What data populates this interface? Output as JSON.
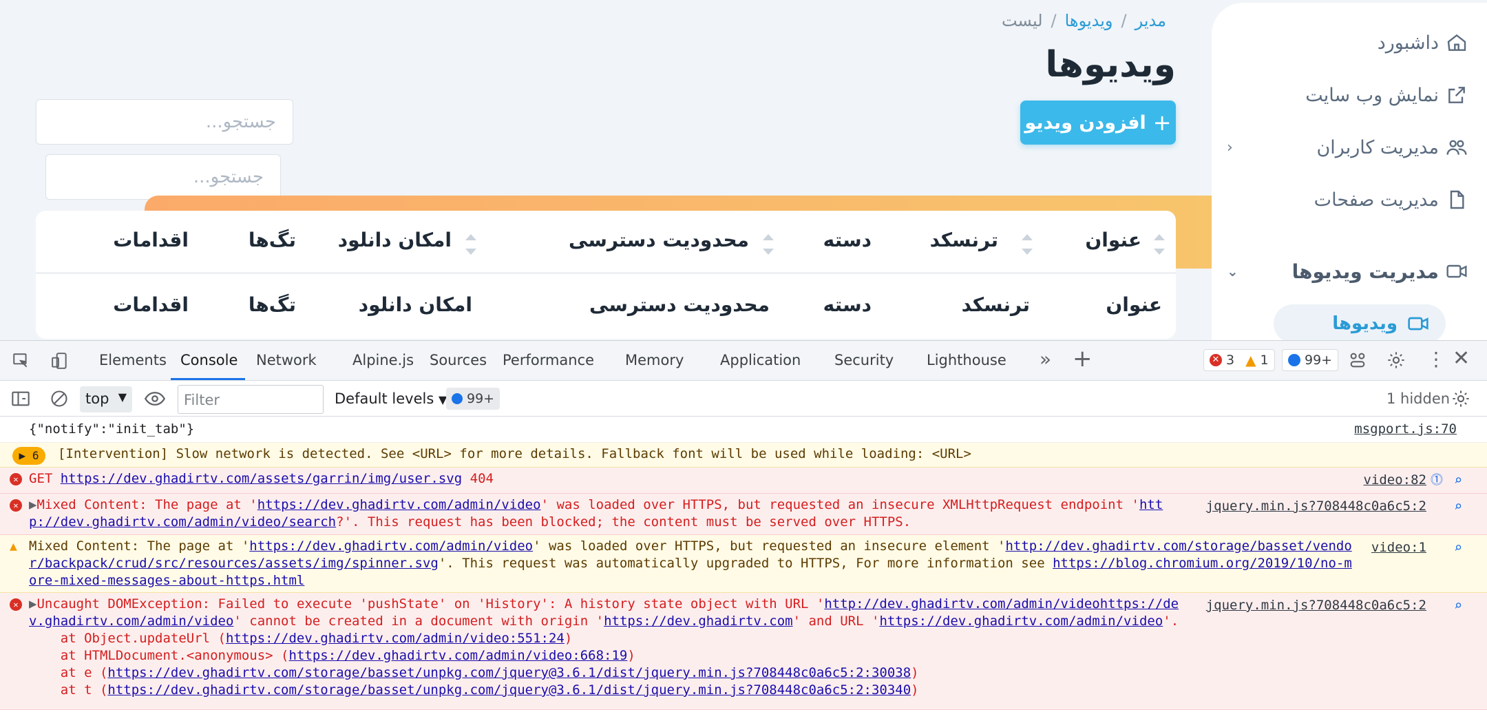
{
  "sidebar": {
    "items": [
      {
        "label": "داشبورد",
        "icon": "home-icon"
      },
      {
        "label": "نمایش وب سایت",
        "icon": "external-link-icon"
      },
      {
        "label": "مدیریت کاربران",
        "icon": "users-icon"
      },
      {
        "label": "مدیریت صفحات",
        "icon": "file-icon"
      }
    ],
    "section": {
      "label": "مدیریت ویدیوها",
      "icon": "video-icon"
    },
    "active_sub": {
      "label": "ویدیوها",
      "icon": "video-icon"
    }
  },
  "header": {
    "breadcrumb": [
      "مدیر",
      "ویدیوها",
      "لیست"
    ],
    "title": "ویدیوها",
    "add_button": "افزودن ویدیو"
  },
  "search": {
    "placeholder": "جستجو..."
  },
  "table": {
    "columns": [
      "عنوان",
      "ترنسکد",
      "دسته",
      "محدودیت دسترسی",
      "امکان دانلود",
      "تگ‌ها",
      "اقدامات"
    ]
  },
  "devtools": {
    "tabs": [
      "Elements",
      "Console",
      "Network",
      "Alpine.js",
      "Sources",
      "Performance",
      "Memory",
      "Application",
      "Security",
      "Lighthouse"
    ],
    "active_tab": "Console",
    "counts": {
      "errors": "3",
      "warnings": "1",
      "messages": "99+"
    },
    "toolbar": {
      "context": "top",
      "filter_placeholder": "Filter",
      "levels": "Default levels",
      "issues": "99+",
      "hidden": "1 hidden"
    },
    "messages": [
      {
        "text": "{\"notify\":\"init_tab\"}",
        "source": "msgport.js:70"
      },
      {
        "badge": "6",
        "text": "[Intervention] Slow network is detected. See <URL> for more details. Fallback font will be used while loading: <URL>"
      },
      {
        "method": "GET",
        "url": "https://dev.ghadirtv.com/assets/garrin/img/user.svg",
        "status": "404",
        "source": "video:82"
      },
      {
        "line1a": "Mixed Content: The page at '",
        "url1": "https://dev.ghadirtv.com/admin/video",
        "line1b": "' was loaded over HTTPS, but requested an insecure XMLHttpRequest endpoint '",
        "url2a": "htt",
        "url2b": "p://dev.ghadirtv.com/admin/video/search",
        "line2": "?'. This request has been blocked; the content must be served over HTTPS.",
        "source": "jquery.min.js?708448c0a6c5:2"
      },
      {
        "line1a": "Mixed Content: The page at '",
        "url1": "https://dev.ghadirtv.com/admin/video",
        "line1b": "' was loaded over HTTPS, but requested an insecure element '",
        "url2a": "http://dev.ghadirtv.com/storage/basset/vendo",
        "url2b": "r/backpack/crud/src/resources/assets/img/spinner.svg",
        "line2": "'. This request was automatically upgraded to HTTPS, For more information see ",
        "url3a": "https://blog.chromium.org/2019/10/no-m",
        "url3b": "ore-mixed-messages-about-https.html",
        "source": "video:1"
      },
      {
        "line1a": "Uncaught DOMException: Failed to execute 'pushState' on 'History': A history state object with URL '",
        "url1a": "http://dev.ghadirtv.com/admin/videohttps://de",
        "url1b": "v.ghadirtv.com/admin/video",
        "line2a": "' cannot be created in a document with origin '",
        "url2": "https://dev.ghadirtv.com",
        "line2b": "' and URL '",
        "url3": "https://dev.ghadirtv.com/admin/video",
        "line2c": "'.",
        "stack": [
          {
            "pre": "    at Object.updateUrl (",
            "url": "https://dev.ghadirtv.com/admin/video:551:24",
            "post": ")"
          },
          {
            "pre": "    at HTMLDocument.<anonymous> (",
            "url": "https://dev.ghadirtv.com/admin/video:668:19",
            "post": ")"
          },
          {
            "pre": "    at e (",
            "url": "https://dev.ghadirtv.com/storage/basset/unpkg.com/jquery@3.6.1/dist/jquery.min.js?708448c0a6c5:2:30038",
            "post": ")"
          },
          {
            "pre": "    at t (",
            "url": "https://dev.ghadirtv.com/storage/basset/unpkg.com/jquery@3.6.1/dist/jquery.min.js?708448c0a6c5:2:30340",
            "post": ")"
          }
        ],
        "source": "jquery.min.js?708448c0a6c5:2"
      }
    ]
  },
  "colors": {
    "accent": "#3bb9ea",
    "link": "#2a9bd6",
    "error_bg": "#fdeeee",
    "warn_bg": "#fffbe6",
    "error_text": "#d41e1e"
  }
}
